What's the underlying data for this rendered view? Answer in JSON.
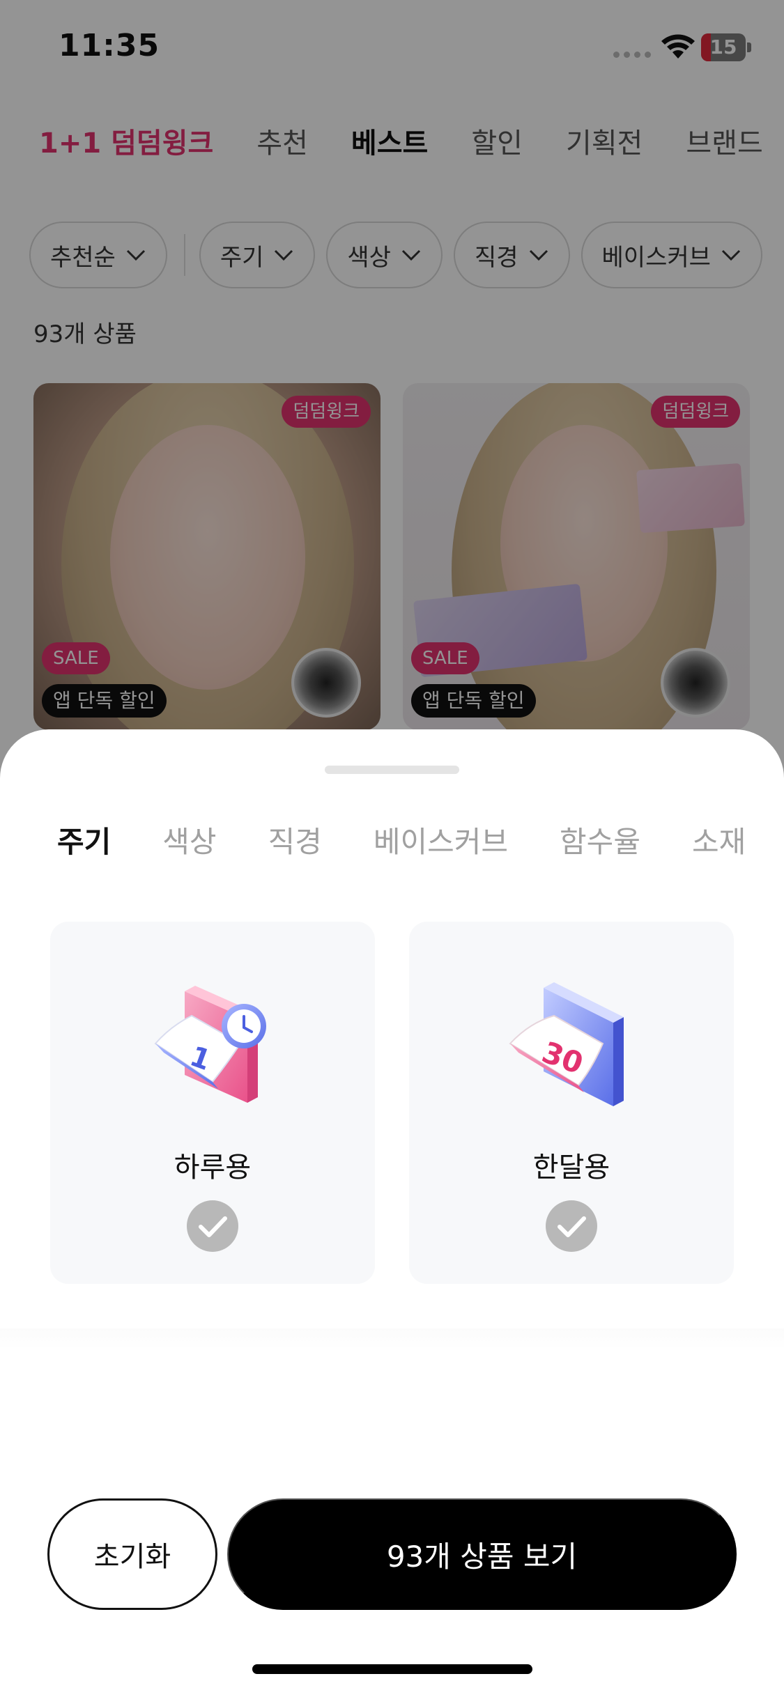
{
  "status": {
    "time": "11:35",
    "battery": "15",
    "battery_color": "#e0293c"
  },
  "top_tabs": [
    "1+1 덤덤윙크",
    "추천",
    "베스트",
    "할인",
    "기획전",
    "브랜드"
  ],
  "filters": [
    "추천순",
    "주기",
    "색상",
    "직경",
    "베이스커브"
  ],
  "product_count": "93개 상품",
  "products": [
    {
      "brand_tag": "덤덤윙크",
      "sale": "SALE",
      "app_tag": "앱 단독 할인"
    },
    {
      "brand_tag": "덤덤윙크",
      "sale": "SALE",
      "app_tag": "앱 단독 할인"
    }
  ],
  "sheet": {
    "tabs": [
      "주기",
      "색상",
      "직경",
      "베이스커브",
      "함수율",
      "소재"
    ],
    "options": [
      {
        "label": "하루용",
        "icon": "daily-calendar-icon"
      },
      {
        "label": "한달용",
        "icon": "monthly-calendar-icon"
      }
    ],
    "reset_label": "초기화",
    "show_label": "93개 상품 보기"
  },
  "colors": {
    "accent": "#e2326f",
    "primary_button": "#000000",
    "check": "#b8b8b8"
  }
}
